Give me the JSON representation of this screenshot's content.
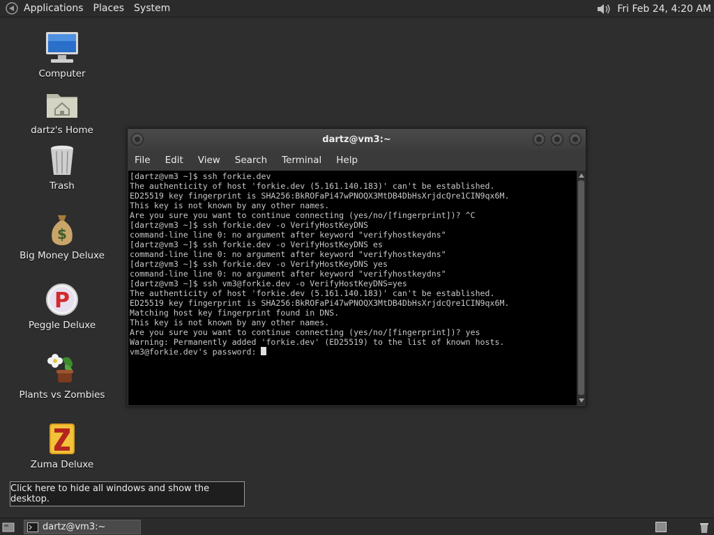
{
  "top_panel": {
    "menus": [
      "Applications",
      "Places",
      "System"
    ],
    "clock": "Fri Feb 24,  4:20 AM",
    "logo_icon": "gnome-foot-icon",
    "volume_icon": "speaker-icon"
  },
  "desktop": {
    "icons": [
      {
        "label": "Computer",
        "icon": "computer-icon"
      },
      {
        "label": "dartz's Home",
        "icon": "home-folder-icon"
      },
      {
        "label": "Trash",
        "icon": "trash-icon"
      },
      {
        "label": "Big Money Deluxe",
        "icon": "money-bag-icon"
      },
      {
        "label": "Peggle Deluxe",
        "icon": "peggle-icon"
      },
      {
        "label": "Plants vs Zombies",
        "icon": "plants-vs-zombies-icon"
      },
      {
        "label": "Zuma Deluxe",
        "icon": "zuma-icon"
      }
    ]
  },
  "terminal": {
    "title": "dartz@vm3:~",
    "menus": [
      "File",
      "Edit",
      "View",
      "Search",
      "Terminal",
      "Help"
    ],
    "lines": [
      "[dartz@vm3 ~]$ ssh forkie.dev",
      "The authenticity of host 'forkie.dev (5.161.140.183)' can't be established.",
      "ED25519 key fingerprint is SHA256:BkROFaPi47wPNOQX3MtDB4DbHsXrjdcQre1CIN9qx6M.",
      "This key is not known by any other names.",
      "Are you sure you want to continue connecting (yes/no/[fingerprint])? ^C",
      "[dartz@vm3 ~]$ ssh forkie.dev -o VerifyHostKeyDNS",
      "command-line line 0: no argument after keyword \"verifyhostkeydns\"",
      "[dartz@vm3 ~]$ ssh forkie.dev -o VerifyHostKeyDNS es",
      "command-line line 0: no argument after keyword \"verifyhostkeydns\"",
      "[dartz@vm3 ~]$ ssh forkie.dev -o VerifyHostKeyDNS yes",
      "command-line line 0: no argument after keyword \"verifyhostkeydns\"",
      "[dartz@vm3 ~]$ ssh vm3@forkie.dev -o VerifyHostKeyDNS=yes",
      "The authenticity of host 'forkie.dev (5.161.140.183)' can't be established.",
      "ED25519 key fingerprint is SHA256:BkROFaPi47wPNOQX3MtDB4DbHsXrjdcQre1CIN9qx6M.",
      "Matching host key fingerprint found in DNS.",
      "This key is not known by any other names.",
      "Are you sure you want to continue connecting (yes/no/[fingerprint])? yes",
      "Warning: Permanently added 'forkie.dev' (ED25519) to the list of known hosts."
    ],
    "prompt_line": "vm3@forkie.dev's password: "
  },
  "tooltip": {
    "text": "Click here to hide all windows and show the desktop."
  },
  "bottom_panel": {
    "taskbar_item": "dartz@vm3:~",
    "show_desktop_icon": "show-desktop-icon",
    "workspace_icon": "workspace-switcher-icon",
    "trash_icon": "trash-applet-icon"
  },
  "colors": {
    "desktop_bg": "#2e2e2e",
    "panel_bg": "#2b2b2b",
    "terminal_bg": "#000000",
    "terminal_fg": "#c8c8c8"
  }
}
